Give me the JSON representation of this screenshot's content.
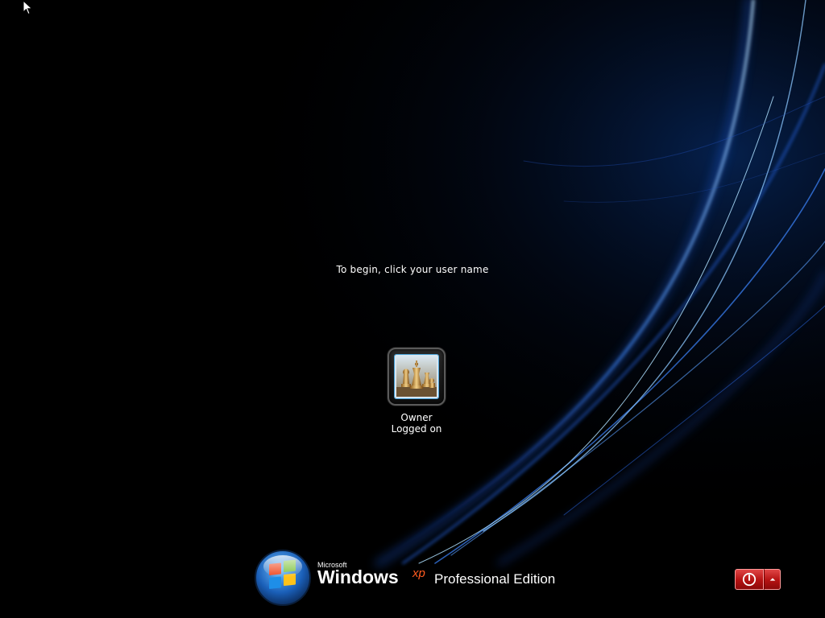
{
  "login": {
    "prompt": "To begin, click your user name"
  },
  "users": [
    {
      "name": "Owner",
      "status": "Logged on",
      "avatar_icon": "chess-pieces-icon"
    }
  ],
  "branding": {
    "microsoft": "Microsoft",
    "windows": "Windows",
    "xp": "xp",
    "edition": "Professional Edition"
  },
  "power": {
    "shutdown_icon": "power-icon",
    "menu_icon": "chevron-up-icon"
  },
  "colors": {
    "background": "#000000",
    "accent_blue": "#2f7fff",
    "xp_orange": "#ff5a1f",
    "power_red": "#c81818"
  }
}
